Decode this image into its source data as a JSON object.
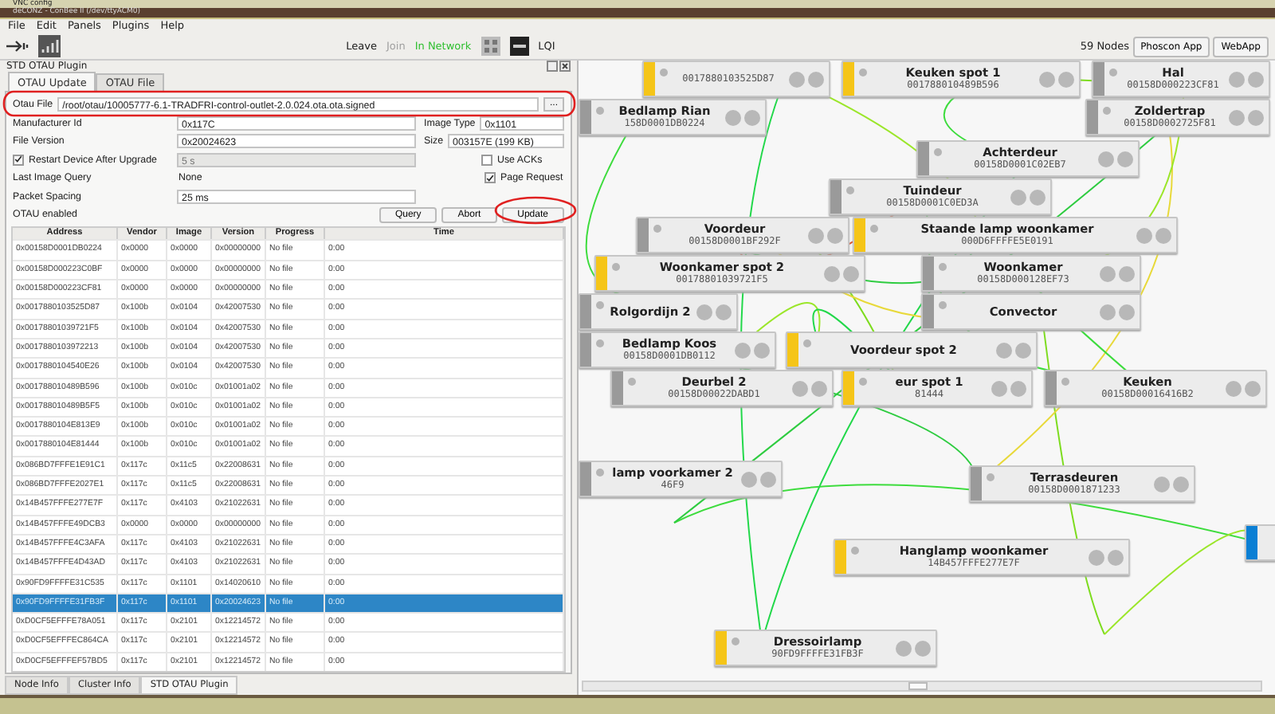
{
  "vnc_title": "VNC config",
  "window": {
    "title": "deCONZ - ConBee II (/dev/ttyACM0)"
  },
  "menu": [
    "File",
    "Edit",
    "Panels",
    "Plugins",
    "Help"
  ],
  "toolbar": {
    "leave": "Leave",
    "join": {
      "label": "Join",
      "disabled": true
    },
    "status": "In Network",
    "lqi": "LQI",
    "node_count": "59 Nodes",
    "buttons": [
      "Phoscon App",
      "WebApp"
    ]
  },
  "panel": {
    "title": "STD OTAU Plugin",
    "tabs": [
      {
        "label": "OTAU Update",
        "selected": true
      },
      {
        "label": "OTAU File",
        "selected": false
      }
    ],
    "form": {
      "otau_file": {
        "label": "Otau File",
        "value": "/root/otau/10005777-6.1-TRADFRI-control-outlet-2.0.024.ota.ota.signed",
        "browse": "..."
      },
      "manufacturer_id": {
        "label": "Manufacturer Id",
        "value": "0x117C"
      },
      "image_type": {
        "label": "Image Type",
        "value": "0x1101"
      },
      "file_version": {
        "label": "File Version",
        "value": "0x20024623"
      },
      "size": {
        "label": "Size",
        "value": "003157E (199 KB)"
      },
      "restart": {
        "label": "Restart Device After Upgrade",
        "checked": true,
        "value": "5 s",
        "disabled": true
      },
      "use_acks": {
        "label": "Use ACKs",
        "checked": false
      },
      "last_image_query": {
        "label": "Last Image Query",
        "value": "None"
      },
      "page_request": {
        "label": "Page Request",
        "checked": true
      },
      "packet_spacing": {
        "label": "Packet Spacing",
        "value": "25 ms"
      },
      "otau_enabled": "OTAU enabled"
    },
    "buttons": [
      "Query",
      "Abort",
      "Update"
    ],
    "table": {
      "columns": [
        "Address",
        "Vendor",
        "Image",
        "Version",
        "Progress",
        "Time"
      ],
      "rows": [
        {
          "cells": [
            "0x00158D0001DB0224",
            "0x0000",
            "0x0000",
            "0x00000000",
            "No file",
            "0:00"
          ],
          "selected": false
        },
        {
          "cells": [
            "0x00158D000223C0BF",
            "0x0000",
            "0x0000",
            "0x00000000",
            "No file",
            "0:00"
          ],
          "selected": false
        },
        {
          "cells": [
            "0x00158D000223CF81",
            "0x0000",
            "0x0000",
            "0x00000000",
            "No file",
            "0:00"
          ],
          "selected": false
        },
        {
          "cells": [
            "0x0017880103525D87",
            "0x100b",
            "0x0104",
            "0x42007530",
            "No file",
            "0:00"
          ],
          "selected": false
        },
        {
          "cells": [
            "0x00178801039721F5",
            "0x100b",
            "0x0104",
            "0x42007530",
            "No file",
            "0:00"
          ],
          "selected": false
        },
        {
          "cells": [
            "0x0017880103972213",
            "0x100b",
            "0x0104",
            "0x42007530",
            "No file",
            "0:00"
          ],
          "selected": false
        },
        {
          "cells": [
            "0x0017880104540E26",
            "0x100b",
            "0x0104",
            "0x42007530",
            "No file",
            "0:00"
          ],
          "selected": false
        },
        {
          "cells": [
            "0x001788010489B596",
            "0x100b",
            "0x010c",
            "0x01001a02",
            "No file",
            "0:00"
          ],
          "selected": false
        },
        {
          "cells": [
            "0x001788010489B5F5",
            "0x100b",
            "0x010c",
            "0x01001a02",
            "No file",
            "0:00"
          ],
          "selected": false
        },
        {
          "cells": [
            "0x0017880104E813E9",
            "0x100b",
            "0x010c",
            "0x01001a02",
            "No file",
            "0:00"
          ],
          "selected": false
        },
        {
          "cells": [
            "0x0017880104E81444",
            "0x100b",
            "0x010c",
            "0x01001a02",
            "No file",
            "0:00"
          ],
          "selected": false
        },
        {
          "cells": [
            "0x086BD7FFFE1E91C1",
            "0x117c",
            "0x11c5",
            "0x22008631",
            "No file",
            "0:00"
          ],
          "selected": false
        },
        {
          "cells": [
            "0x086BD7FFFE2027E1",
            "0x117c",
            "0x11c5",
            "0x22008631",
            "No file",
            "0:00"
          ],
          "selected": false
        },
        {
          "cells": [
            "0x14B457FFFE277E7F",
            "0x117c",
            "0x4103",
            "0x21022631",
            "No file",
            "0:00"
          ],
          "selected": false
        },
        {
          "cells": [
            "0x14B457FFFE49DCB3",
            "0x0000",
            "0x0000",
            "0x00000000",
            "No file",
            "0:00"
          ],
          "selected": false
        },
        {
          "cells": [
            "0x14B457FFFE4C3AFA",
            "0x117c",
            "0x4103",
            "0x21022631",
            "No file",
            "0:00"
          ],
          "selected": false
        },
        {
          "cells": [
            "0x14B457FFFE4D43AD",
            "0x117c",
            "0x4103",
            "0x21022631",
            "No file",
            "0:00"
          ],
          "selected": false
        },
        {
          "cells": [
            "0x90FD9FFFFE31C535",
            "0x117c",
            "0x1101",
            "0x14020610",
            "No file",
            "0:00"
          ],
          "selected": false
        },
        {
          "cells": [
            "0x90FD9FFFFE31FB3F",
            "0x117c",
            "0x1101",
            "0x20024623",
            "No file",
            "0:00"
          ],
          "selected": true
        },
        {
          "cells": [
            "0xD0CF5EFFFE78A051",
            "0x117c",
            "0x2101",
            "0x12214572",
            "No file",
            "0:00"
          ],
          "selected": false
        },
        {
          "cells": [
            "0xD0CF5EFFFEC864CA",
            "0x117c",
            "0x2101",
            "0x12214572",
            "No file",
            "0:00"
          ],
          "selected": false
        },
        {
          "cells": [
            "0xD0CF5EFFFEF57BD5",
            "0x117c",
            "0x2101",
            "0x12214572",
            "No file",
            "0:00"
          ],
          "selected": false
        }
      ]
    }
  },
  "bottom_tabs": [
    {
      "label": "Node Info",
      "selected": false
    },
    {
      "label": "Cluster Info",
      "selected": false
    },
    {
      "label": "STD OTAU Plugin",
      "selected": true
    }
  ],
  "graph": {
    "nodes": [
      {
        "address": "0017880103525D87",
        "color": "#f5c518"
      },
      {
        "title": "Keuken spot 1",
        "address": "001788010489B596",
        "color": "#f5c518"
      },
      {
        "title": "Hal",
        "address": "00158D000223CF81",
        "color": "#9a9a9a"
      },
      {
        "title": "Bedlamp Rian",
        "address": "158D0001DB0224",
        "color": "#9a9a9a"
      },
      {
        "title": "Zoldertrap",
        "address": "00158D0002725F81",
        "color": "#9a9a9a"
      },
      {
        "title": "Achterdeur",
        "address": "00158D0001C02EB7",
        "color": "#9a9a9a"
      },
      {
        "title": "Tuindeur",
        "address": "00158D0001C0ED3A",
        "color": "#9a9a9a"
      },
      {
        "title": "Voordeur",
        "address": "00158D0001BF292F",
        "color": "#9a9a9a"
      },
      {
        "title": "Staande lamp woonkamer",
        "address": "000D6FFFFE5E0191",
        "color": "#f5c518"
      },
      {
        "title": "Woonkamer spot 2",
        "address": "00178801039721F5",
        "color": "#f5c518"
      },
      {
        "title": "Woonkamer",
        "address": "00158D000128EF73",
        "color": "#9a9a9a"
      },
      {
        "title": "Rolgordijn 2",
        "color": "#9a9a9a"
      },
      {
        "title": "Convector",
        "color": "#9a9a9a"
      },
      {
        "title": "Bedlamp Koos",
        "address": "00158D0001DB0112",
        "color": "#9a9a9a"
      },
      {
        "title": "Voordeur spot 2",
        "color": "#f5c518"
      },
      {
        "title": "Deurbel 2",
        "address": "00158D00022DABD1",
        "color": "#9a9a9a"
      },
      {
        "title": "eur spot 1",
        "address": "81444",
        "color": "#f5c518"
      },
      {
        "title": "Keuken",
        "address": "00158D00016416B2",
        "color": "#9a9a9a"
      },
      {
        "title": "lamp voorkamer 2",
        "address": "46F9",
        "color": "#9a9a9a"
      },
      {
        "title": "Terrasdeuren",
        "address": "00158D0001871233",
        "color": "#9a9a9a"
      },
      {
        "color": "#0a7fd4"
      },
      {
        "title": "Hanglamp woonkamer",
        "address": "14B457FFFE277E7F",
        "color": "#f5c518"
      },
      {
        "title": "Dressoirlamp",
        "address": "90FD9FFFFE31FB3F",
        "color": "#f5c518"
      }
    ]
  }
}
